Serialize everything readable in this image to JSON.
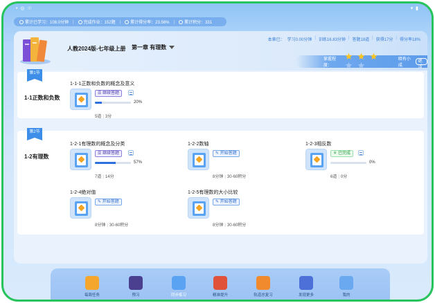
{
  "status": {
    "left": "• ◎ ☉",
    "right": "▾ ▮"
  },
  "stats": [
    {
      "label": "累计已学习：108.0分钟"
    },
    {
      "label": "完成作业：152题"
    },
    {
      "label": "累计得分率：23.56%"
    },
    {
      "label": "累计积分：331"
    }
  ],
  "header": {
    "textbook": "人教2024版-七年级上册",
    "chapter": "第一章 有理数",
    "week": [
      "本章已：",
      "学习0.00分钟",
      "训练16.83分钟",
      "答题18道",
      "获得17分",
      "得分率18%"
    ],
    "mastery_label": "掌握程度：",
    "mastery_stars": 3,
    "mastery_total": 5,
    "mastery_hint": "暗有小成",
    "unlock_label": "绝活"
  },
  "sections": [
    {
      "badge": "第1节",
      "title": "1-1正数和负数",
      "lessons": [
        {
          "name": "1-1-1正数和负数的概念及意义",
          "tag": "继续答题",
          "tag_type": "cont",
          "progress": 20,
          "pct_label": "20%",
          "meta_a": "5道",
          "meta_b": "3分"
        }
      ]
    },
    {
      "badge": "第2节",
      "title": "1-2有理数",
      "lessons": [
        {
          "name": "1-2-1有理数的概念及分类",
          "tag": "继续答题",
          "tag_type": "cont",
          "progress": 57,
          "pct_label": "57%",
          "meta_a": "7道",
          "meta_b": "14分"
        },
        {
          "name": "1-2-2数轴",
          "tag": "开始答题",
          "tag_type": "start",
          "meta_a": "8分钟",
          "meta_b": "30-60积分"
        },
        {
          "name": "1-2-3相反数",
          "tag": "已完成",
          "tag_type": "done",
          "progress": 0,
          "pct_label": "0%",
          "meta_a": "6道",
          "meta_b": "0分"
        },
        {
          "name": "1-2-4绝对值",
          "tag": "开始答题",
          "tag_type": "start",
          "meta_a": "8分钟",
          "meta_b": "30-60积分"
        },
        {
          "name": "1-2-5有理数的大小比较",
          "tag": "开始答题",
          "tag_type": "start",
          "meta_a": "8分钟",
          "meta_b": "30-60积分"
        }
      ]
    }
  ],
  "dock": [
    {
      "label": "每周任务",
      "icon": "task-icon",
      "color": "#f4a72c"
    },
    {
      "label": "预习",
      "icon": "video-icon",
      "color": "#4b3f8f"
    },
    {
      "label": "同步练习",
      "icon": "practice-icon",
      "color": "#5aa3f2"
    },
    {
      "label": "精准提升",
      "icon": "cap-icon",
      "color": "#e0523a"
    },
    {
      "label": "轨道总复习",
      "icon": "target-icon",
      "color": "#f08a2c"
    },
    {
      "label": "发现更多",
      "icon": "binoculars-icon",
      "color": "#4d6fd8"
    },
    {
      "label": "我的",
      "icon": "backpack-icon",
      "color": "#6aa8ef"
    }
  ]
}
